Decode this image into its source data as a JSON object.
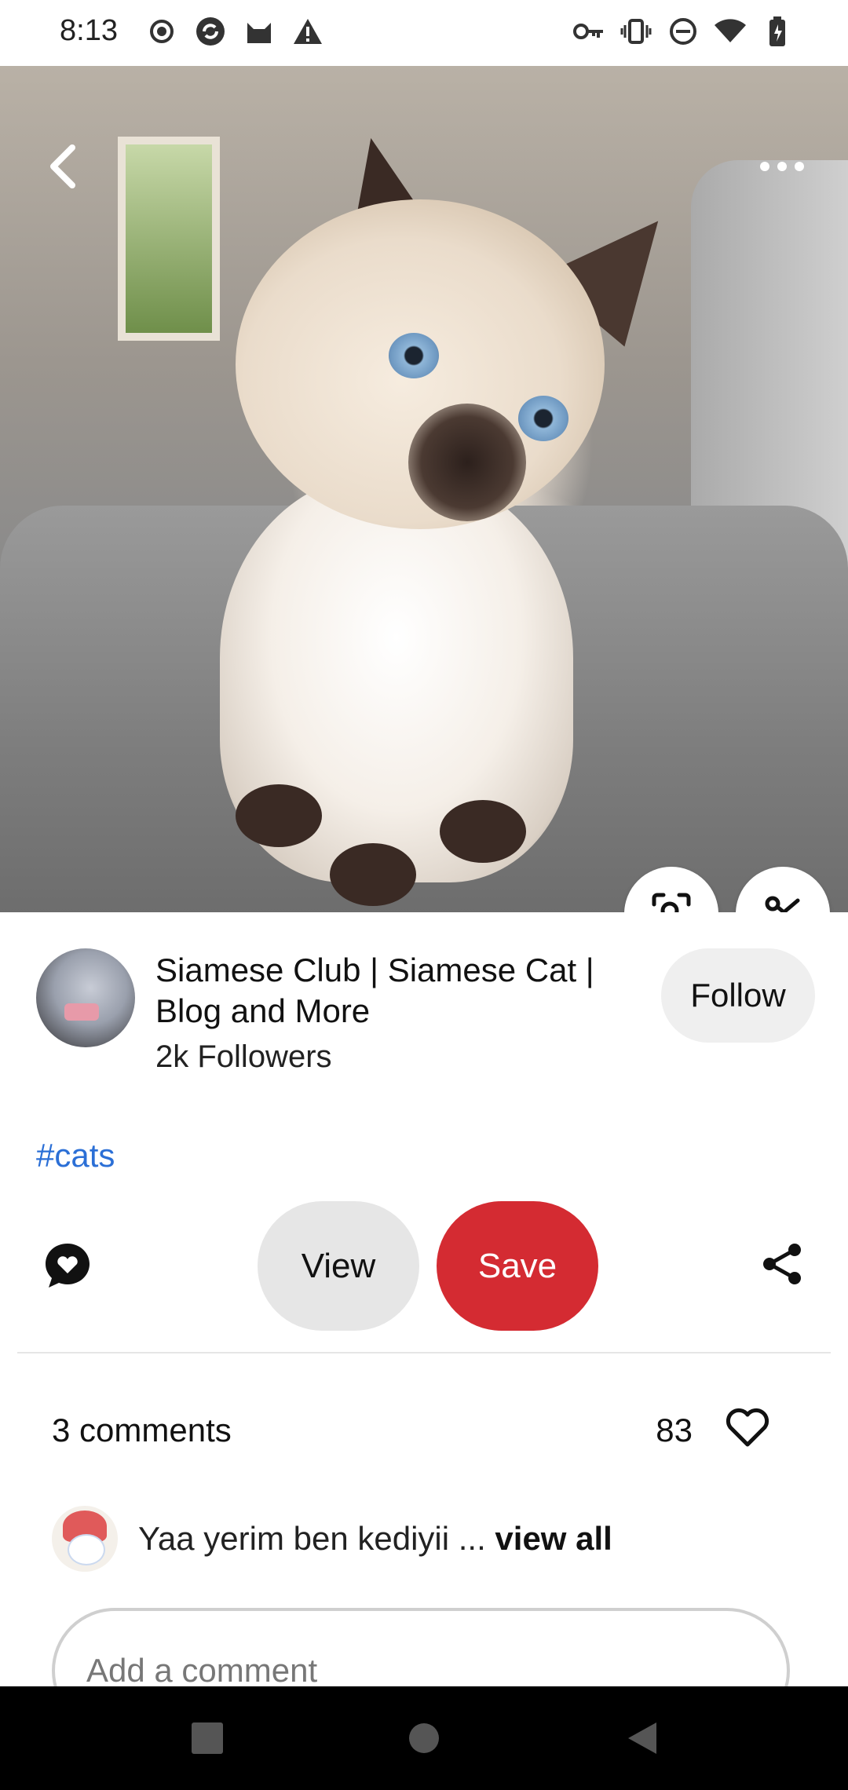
{
  "status_bar": {
    "time": "8:13",
    "left_icons": [
      "record-icon",
      "sync-icon",
      "cat-app-icon",
      "warning-icon"
    ],
    "right_icons": [
      "vpn-key-icon",
      "vibrate-icon",
      "dnd-icon",
      "wifi-icon",
      "battery-icon"
    ]
  },
  "hero": {
    "back_icon": "chevron-left-icon",
    "more_icon": "more-horizontal-icon",
    "visual_search_icon": "visual-search-icon",
    "cutout_icon": "scissors-icon"
  },
  "creator": {
    "name": "Siamese Club | Siamese Cat  | Blog and More",
    "followers": "2k Followers",
    "follow_label": "Follow"
  },
  "hashtag": "#cats",
  "actions": {
    "comment_icon": "comment-heart-icon",
    "view_label": "View",
    "save_label": "Save",
    "share_icon": "share-icon",
    "save_color": "#d42b32"
  },
  "comments": {
    "count_label": "3 comments",
    "likes": "83",
    "preview_text": "Yaa yerim ben kediyii ... ",
    "view_all": "view all",
    "add_placeholder": "Add a comment"
  },
  "nav": {
    "icons": [
      "recents-icon",
      "home-icon",
      "back-icon"
    ]
  }
}
